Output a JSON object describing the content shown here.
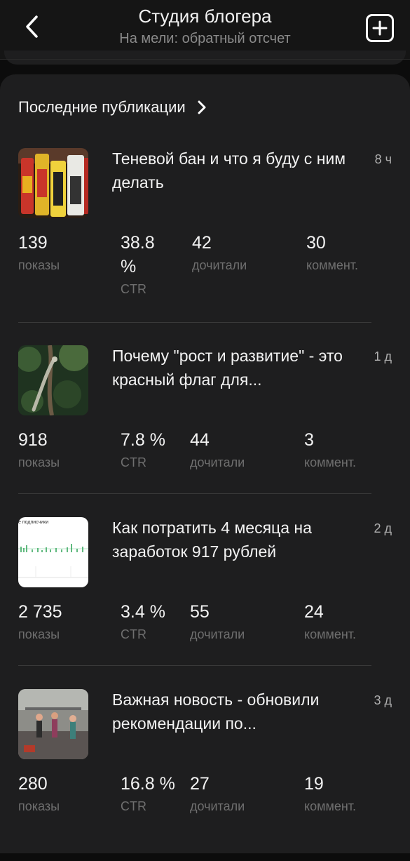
{
  "header": {
    "title": "Студия блогера",
    "subtitle": "На мели: обратный отсчет"
  },
  "section": {
    "title": "Последние публикации"
  },
  "posts": [
    {
      "title": "Теневой бан и что я буду с ним делать",
      "time": "8 ч",
      "thumb_icon": "energy-drink-cans-image",
      "stats": {
        "views": "139",
        "views_label": "показы",
        "ctr_num": "38.8",
        "ctr_unit": "%",
        "ctr_label": "CTR",
        "read": "42",
        "read_label": "дочитали",
        "comments": "30",
        "comments_label": "коммент."
      }
    },
    {
      "title": "Почему \"рост и развитие\" - это красный флаг для...",
      "time": "1 д",
      "thumb_icon": "lizard-on-tree-image",
      "stats": {
        "views": "918",
        "views_label": "показы",
        "ctr": "7.8 %",
        "ctr_label": "CTR",
        "read": "44",
        "read_label": "дочитали",
        "comments": "3",
        "comments_label": "коммент."
      }
    },
    {
      "title": "Как потратить 4 месяца на заработок 917 рублей",
      "time": "2 д",
      "thumb_icon": "subscribers-chart-image",
      "thumb_text": "е подписчики",
      "stats": {
        "views": "2 735",
        "views_label": "показы",
        "ctr": "3.4 %",
        "ctr_label": "CTR",
        "read": "55",
        "read_label": "дочитали",
        "comments": "24",
        "comments_label": "коммент."
      }
    },
    {
      "title": "Важная новость - обновили рекомендации по...",
      "time": "3 д",
      "thumb_icon": "gym-people-image",
      "stats": {
        "views": "280",
        "views_label": "показы",
        "ctr": "16.8 %",
        "ctr_label": "CTR",
        "read": "27",
        "read_label": "дочитали",
        "comments": "19",
        "comments_label": "коммент."
      }
    }
  ],
  "colors": {
    "background": "#0c0c0c",
    "card": "#1e1e1f",
    "text": "#f2f2f2",
    "muted": "#6f6f6f"
  }
}
